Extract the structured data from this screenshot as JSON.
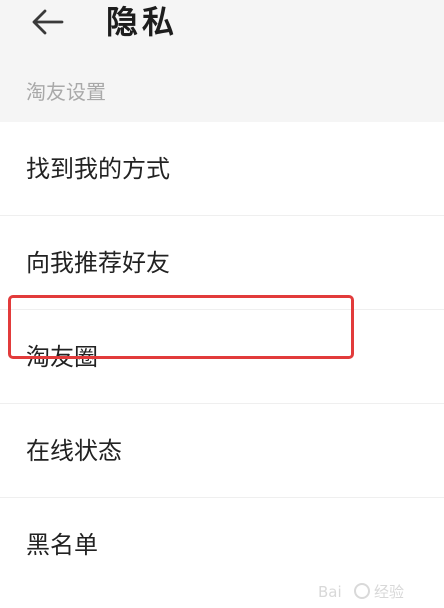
{
  "header": {
    "title": "隐私",
    "back_icon": "arrow-left-icon"
  },
  "section": {
    "label": "淘友设置"
  },
  "items": [
    {
      "label": "找到我的方式"
    },
    {
      "label": "向我推荐好友"
    },
    {
      "label": "淘友圈"
    },
    {
      "label": "在线状态"
    },
    {
      "label": "黑名单"
    }
  ],
  "colors": {
    "header_bg": "#f5f5f5",
    "highlight": "#e23b3b",
    "section_text": "#a9a9a9"
  }
}
